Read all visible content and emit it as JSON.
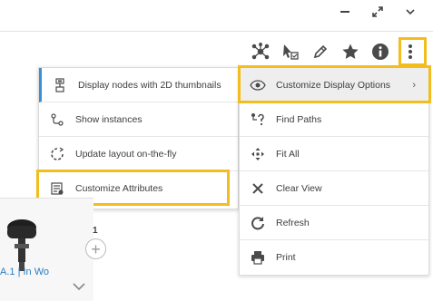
{
  "window": {
    "minimize_icon": "minimize-icon",
    "restore_icon": "expand-arrows-icon",
    "collapse_icon": "chevron-down-icon"
  },
  "toolbar": {
    "icons": [
      "network-nodes-icon",
      "select-cursor-icon",
      "pencil-icon",
      "star-icon",
      "info-icon",
      "more-vertical-icon"
    ]
  },
  "left_menu": {
    "items": [
      {
        "label": "Display nodes with 2D thumbnails",
        "icon": "thumbnail-nodes-icon"
      },
      {
        "label": "Show instances",
        "icon": "instances-icon"
      },
      {
        "label": "Update layout on-the-fly",
        "icon": "refresh-layout-icon"
      },
      {
        "label": "Customize Attributes",
        "icon": "attributes-list-icon"
      }
    ]
  },
  "right_menu": {
    "items": [
      {
        "label": "Customize Display Options",
        "icon": "eye-gear-icon",
        "submenu_arrow": "›"
      },
      {
        "label": "Find Paths",
        "icon": "find-paths-icon"
      },
      {
        "label": "Fit All",
        "icon": "fit-all-icon"
      },
      {
        "label": "Clear View",
        "icon": "close-x-icon"
      },
      {
        "label": "Refresh",
        "icon": "refresh-icon"
      },
      {
        "label": "Print",
        "icon": "printer-icon"
      }
    ]
  },
  "node_card": {
    "label": "A.1 | In Wo",
    "count": "1",
    "expand_symbol": "+"
  },
  "colors": {
    "highlight": "#f2bd1d",
    "selected_bar": "#3b8fd2",
    "link": "#2a7ec2",
    "icon": "#4a4a4a"
  }
}
